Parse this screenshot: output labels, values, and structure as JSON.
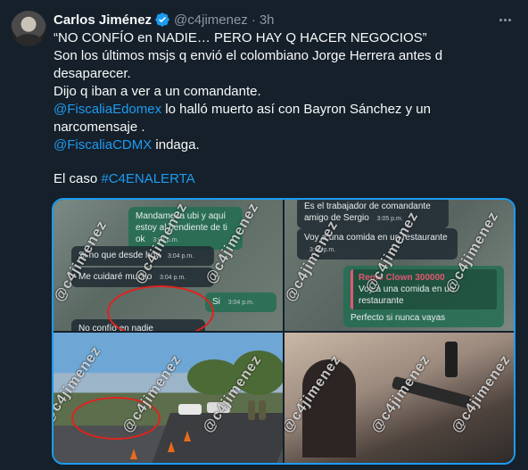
{
  "author": {
    "name": "Carlos Jiménez",
    "handle": "@c4jimenez",
    "separator": "·",
    "time": "3h"
  },
  "tweet": {
    "line1": "“NO CONFÍO en NADIE… PERO HAY Q HACER NEGOCIOS”",
    "line2": "Son los últimos msjs q envió el colombiano Jorge Herrera antes d desaparecer.",
    "line3": "Dijo q iban a ver a un comandante.",
    "mention1": "@FiscaliaEdomex",
    "line4_rest": " lo halló muerto así con Bayron Sánchez y un narcomensaje .",
    "mention2": "@FiscaliaCDMX",
    "line5_rest": " indaga.",
    "case_prefix": "El caso ",
    "hashtag": "#C4ENALERTA"
  },
  "media": {
    "chat1": {
      "msg1": "Mandame la ubi y aquí estoy al pendiente de ti ok",
      "msg1_time": "3:04 p.m.",
      "msg2": "Si no que desde hoy",
      "msg2_time": "3:04 p.m.",
      "msg3": "Me cuidaré mucho",
      "msg3_time": "3:04 p.m.",
      "msg4": "Si",
      "msg4_time": "3:04 p.m.",
      "msg5": "No confío en nadie"
    },
    "chat2": {
      "msg1": "Es el trabajador de comandante amigo de Sergio",
      "msg1_time": "3:05 p.m.",
      "msg2": "Voy a una comida en un restaurante",
      "msg2_time": "3:05 p.m.",
      "quote_from": "Regio Clown 300000",
      "quote_text": "Voy a una comida en un restaurante",
      "msg3": "Perfecto si nunca vayas"
    },
    "watermark": "@c4jimenez"
  },
  "colors": {
    "background": "#15202b",
    "text": "#f7f9f9",
    "secondary": "#8b98a5",
    "link": "#1d9bf0",
    "verified": "#1d9bf0"
  },
  "icons": {
    "verified": "verified-badge-icon",
    "more": "more-options-icon"
  }
}
